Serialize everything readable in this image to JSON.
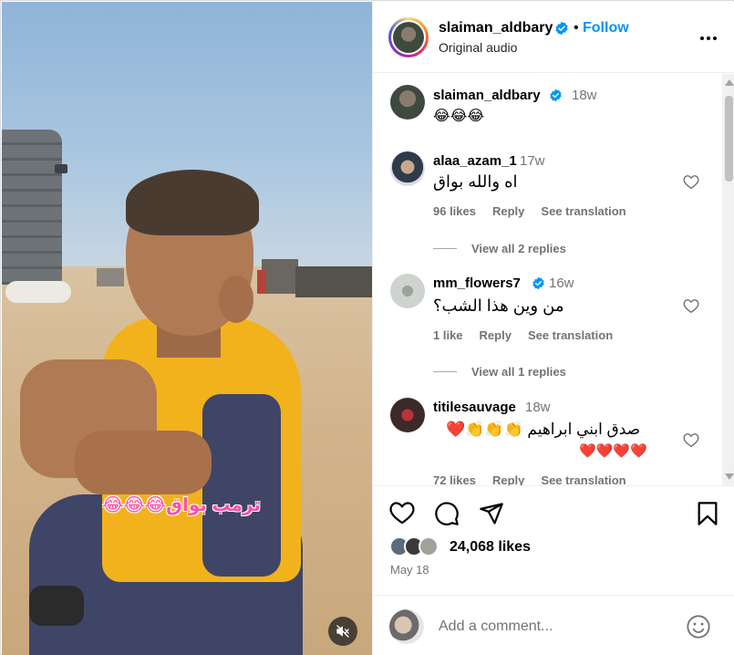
{
  "post": {
    "username": "slaiman_aldbary",
    "follow_label": "Follow",
    "dot": "•",
    "audio": "Original audio",
    "video_caption": "ترمب بواق😂😂😂"
  },
  "caption_comment": {
    "username": "slaiman_aldbary",
    "time": "18w",
    "text": "😂😂😂"
  },
  "comments": [
    {
      "username": "alaa_azam_1",
      "time": "17w",
      "text": "اه والله بواق",
      "likes": "96 likes",
      "reply": "Reply",
      "translate": "See translation",
      "view_replies": "View all 2 replies"
    },
    {
      "username": "mm_flowers7",
      "time": "16w",
      "text": "من وين هذا الشب؟",
      "likes": "1 like",
      "reply": "Reply",
      "translate": "See translation",
      "view_replies": "View all 1 replies"
    },
    {
      "username": "titilesauvage",
      "time": "18w",
      "text_line1": "صدق ابني ابراهيم 👏👏👏❤️",
      "text_line2": "❤️❤️❤️❤️",
      "likes": "72 likes",
      "reply": "Reply",
      "translate": "See translation"
    }
  ],
  "stats": {
    "likes": "24,068 likes",
    "date": "May 18"
  },
  "add_comment": {
    "placeholder": "Add a comment..."
  },
  "colors": {
    "accent": "#0095f6",
    "secondary_text": "#737373",
    "border": "#dbdbdb"
  },
  "icons": [
    "verified-badge-icon",
    "more-options-icon",
    "heart-icon",
    "comment-icon",
    "share-icon",
    "bookmark-icon",
    "emoji-icon",
    "mute-icon"
  ]
}
